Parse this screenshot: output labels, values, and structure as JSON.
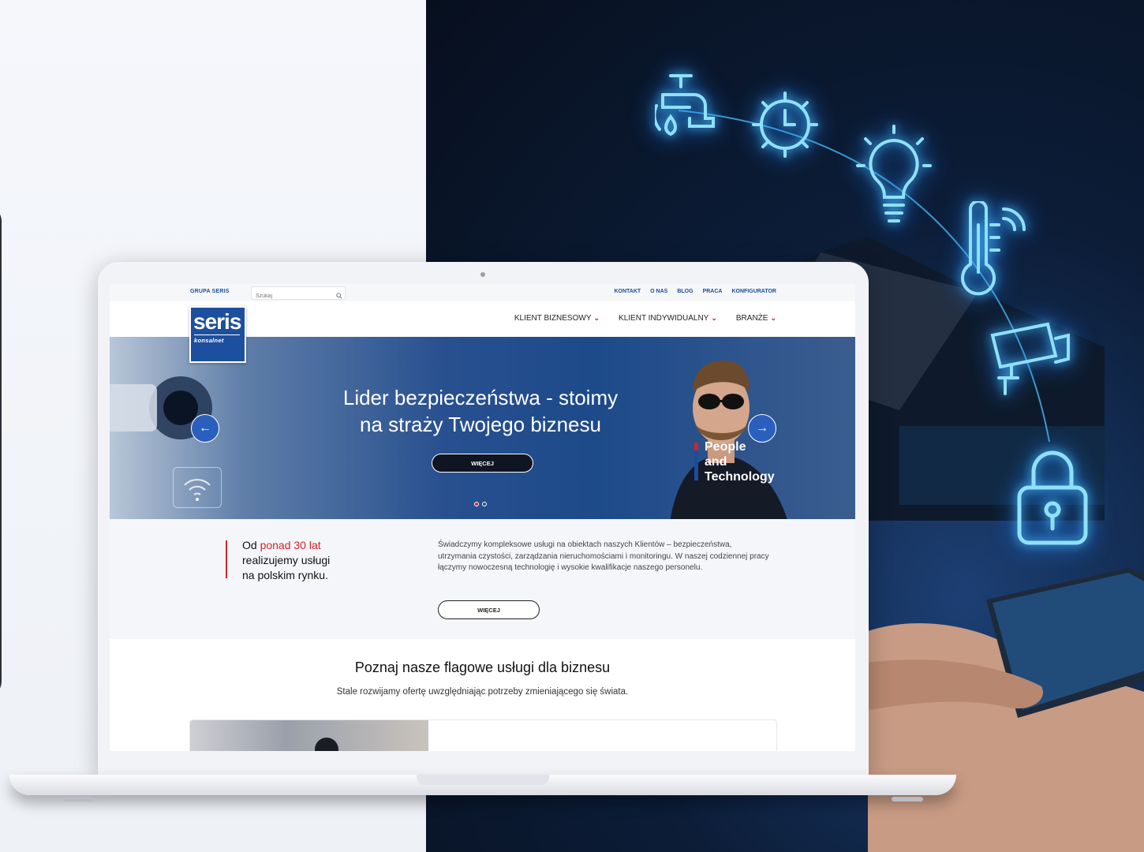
{
  "site": {
    "topbar": {
      "group_label": "GRUPA SERIS",
      "search_placeholder": "Szukaj",
      "links": [
        "KONTAKT",
        "O NAS",
        "BLOG",
        "PRACA",
        "KONFIGURATOR"
      ]
    },
    "logo": {
      "word": "seris",
      "sub": "konsalnet"
    },
    "nav": {
      "items": [
        "KLIENT BIZNESOWY",
        "KLIENT INDYWIDUALNY",
        "BRANŻE"
      ]
    },
    "hero": {
      "title_line1": "Lider bezpieczeństwa - stoimy",
      "title_line2": "na straży Twojego biznesu",
      "button": "WIĘCEJ",
      "tagline1": "People",
      "tagline2": "and",
      "tagline3": "Technology",
      "slides_total": 2,
      "active_slide": 1
    },
    "about": {
      "lead_prefix": "Od ",
      "lead_highlight": "ponad 30 lat",
      "lead_line2": "realizujemy usługi",
      "lead_line3": "na polskim rynku.",
      "body": "Świadczymy kompleksowe usługi na obiektach naszych Klientów – bezpieczeństwa, utrzymania czystości, zarządzania nieruchomościami i monitoringu. W naszej codziennej pracy łączymy nowoczesną technologię i wysokie kwalifikacje naszego personelu.",
      "button": "WIĘCEJ"
    },
    "flagship": {
      "title": "Poznaj nasze flagowe usługi dla biznesu",
      "subtitle": "Stale rozwijamy ofertę uwzględniając potrzeby zmieniającego się świata."
    }
  },
  "icons": [
    "faucet-icon",
    "gear-clock-icon",
    "light-bulb-icon",
    "thermometer-icon",
    "security-camera-icon",
    "padlock-icon",
    "search-icon",
    "arrow-left-icon",
    "arrow-right-icon",
    "chevron-down-icon"
  ],
  "colors": {
    "brand_blue": "#1d4f9f",
    "accent_red": "#d3232a",
    "glow": "#4fc3ff"
  }
}
